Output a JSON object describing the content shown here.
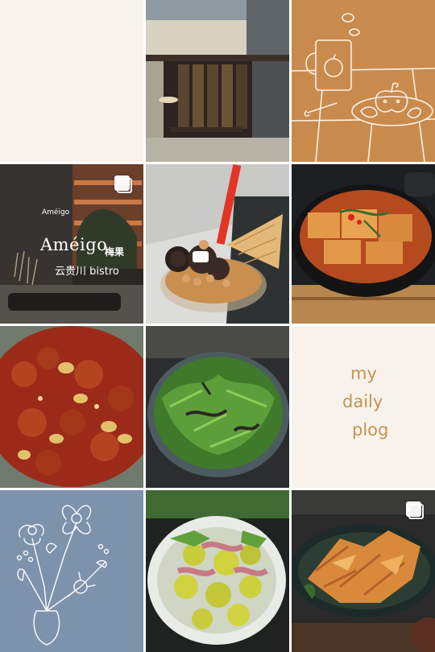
{
  "grid": {
    "tiles": [
      {
        "name": "blank-cream-tile",
        "alt": ""
      },
      {
        "name": "restaurant-exterior-photo"
      },
      {
        "name": "mug-and-apple-doodle-tile"
      },
      {
        "name": "ameigo-sign-photo",
        "carousel": true
      },
      {
        "name": "ice-cream-cone-photo"
      },
      {
        "name": "braised-tofu-pot-photo"
      },
      {
        "name": "spicy-chicken-peanuts-photo"
      },
      {
        "name": "green-vegetable-salad-photo"
      },
      {
        "name": "daily-plog-text-tile"
      },
      {
        "name": "flower-vase-doodle-tile"
      },
      {
        "name": "brussels-sprouts-bacon-photo"
      },
      {
        "name": "fried-tofu-skin-photo",
        "carousel": true
      }
    ]
  },
  "sign": {
    "small": "Améigo",
    "brand": "Améigo",
    "brand_cn": "梅果",
    "sub": "云贵川 bistro"
  },
  "plog": {
    "line1": "my",
    "line2": "daily",
    "line3": "plog"
  },
  "colors": {
    "cream": "#f7f3ec",
    "terracotta": "#c98a4d",
    "dusty_blue": "#7d92ab",
    "plog_text": "#c9924f"
  }
}
